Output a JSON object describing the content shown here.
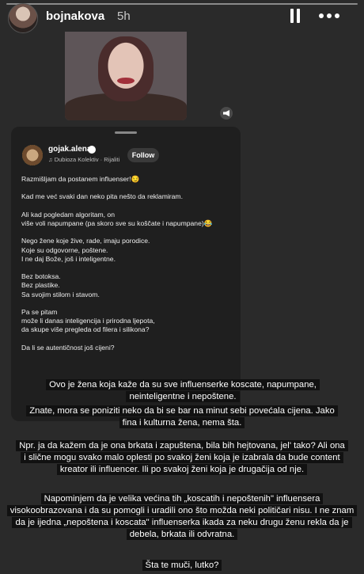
{
  "header": {
    "username": "bojnakova",
    "time": "5h",
    "icons": [
      "pause-icon",
      "more-icon"
    ]
  },
  "post": {
    "username": "gojak.alena",
    "music": "♫ Dubioza Kolektiv · Rijaliti",
    "follow_label": "Follow",
    "paragraphs": [
      "Razmišljam da postanem influenser!😏",
      "Kad me već svaki dan neko pita nešto da reklamiram.",
      "Ali kad pogledam algoritam, on\nviše voli napumpane (pa skoro sve su koščate i napumpane)😂",
      "Nego žene koje žive, rade, imaju porodice.\nKoje su odgovorne, poštene.\nI ne daj Bože, još i inteligentne.",
      "Bez botoksa.\nBez plastike.\nSa svojim stilom i stavom.",
      "Pa se pitam\nmože li danas inteligencija i prirodna ljepota,\nda skupe više pregleda od filera i silikona?",
      "Da li se autentičnost još cijeni?"
    ]
  },
  "captions": {
    "c1": "Ovo je žena koja kaže da su sve influenserke koscate, napumpane, neinteligentne i nepoštene.",
    "c2": "Znate, mora se poniziti neko da bi se bar na minut sebi povećala cijena. Jako fina i kulturna žena, nema šta.",
    "c3": "Npr. ja da kažem da je ona brkata i zapuštena, bila bih hejtovana, jel' tako? Ali ona i slične mogu svako malo oplesti po svakoj ženi koja je izabrala da bude content kreator ili influencer. Ili po svakoj ženi koja je drugačija od nje.",
    "c4": "Napominjem da je velika većina tih „koscatih i nepoštenih\" influensera visokoobrazovana i da su pomogli i uradili ono što možda neki političari nisu. I ne znam da je ijedna „nepoštena i koscata\" influenserka ikada za neku drugu ženu rekla da je debela, brkata ili odvratna.",
    "c5": "Šta te muči, lutko?"
  }
}
